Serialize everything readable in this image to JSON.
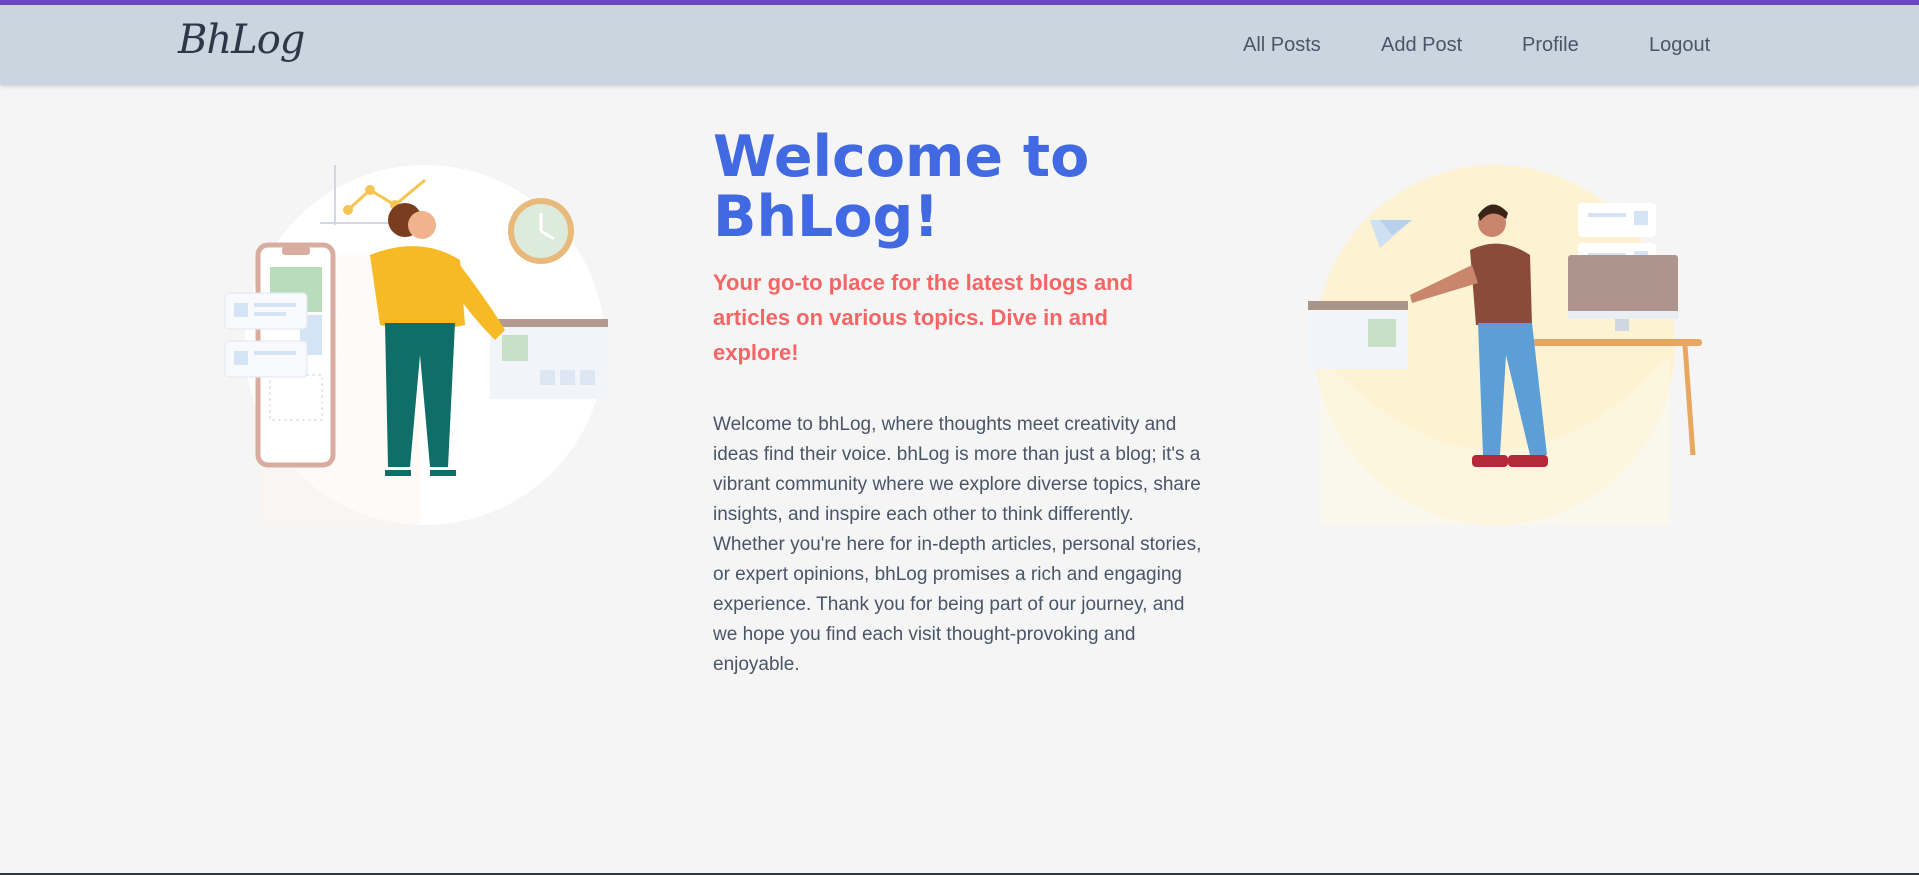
{
  "navbar": {
    "logo_text": "BhLog",
    "links": [
      "All Posts",
      "Add Post",
      "Profile",
      "Logout"
    ]
  },
  "hero": {
    "title_line1": "Welcome to",
    "title_line2": "BhLog!",
    "subtitle": "Your go-to place for the latest blogs and articles on various topics. Dive in and explore!",
    "body": "Welcome to bhLog, where thoughts meet creativity and ideas find their voice. bhLog is more than just a blog; it's a vibrant community where we explore diverse topics, share insights, and inspire each other to think differently. Whether you're here for in-depth articles, personal stories, or expert opinions, bhLog promises a rich and engaging experience. Thank you for being part of our journey, and we hope you find each visit thought-provoking and enjoyable."
  },
  "colors": {
    "accent_bar": "#6b46c1",
    "navbar_bg": "#cbd5e0",
    "title": "#4169e1",
    "subtitle": "#f56565",
    "body_text": "#4a5568"
  }
}
